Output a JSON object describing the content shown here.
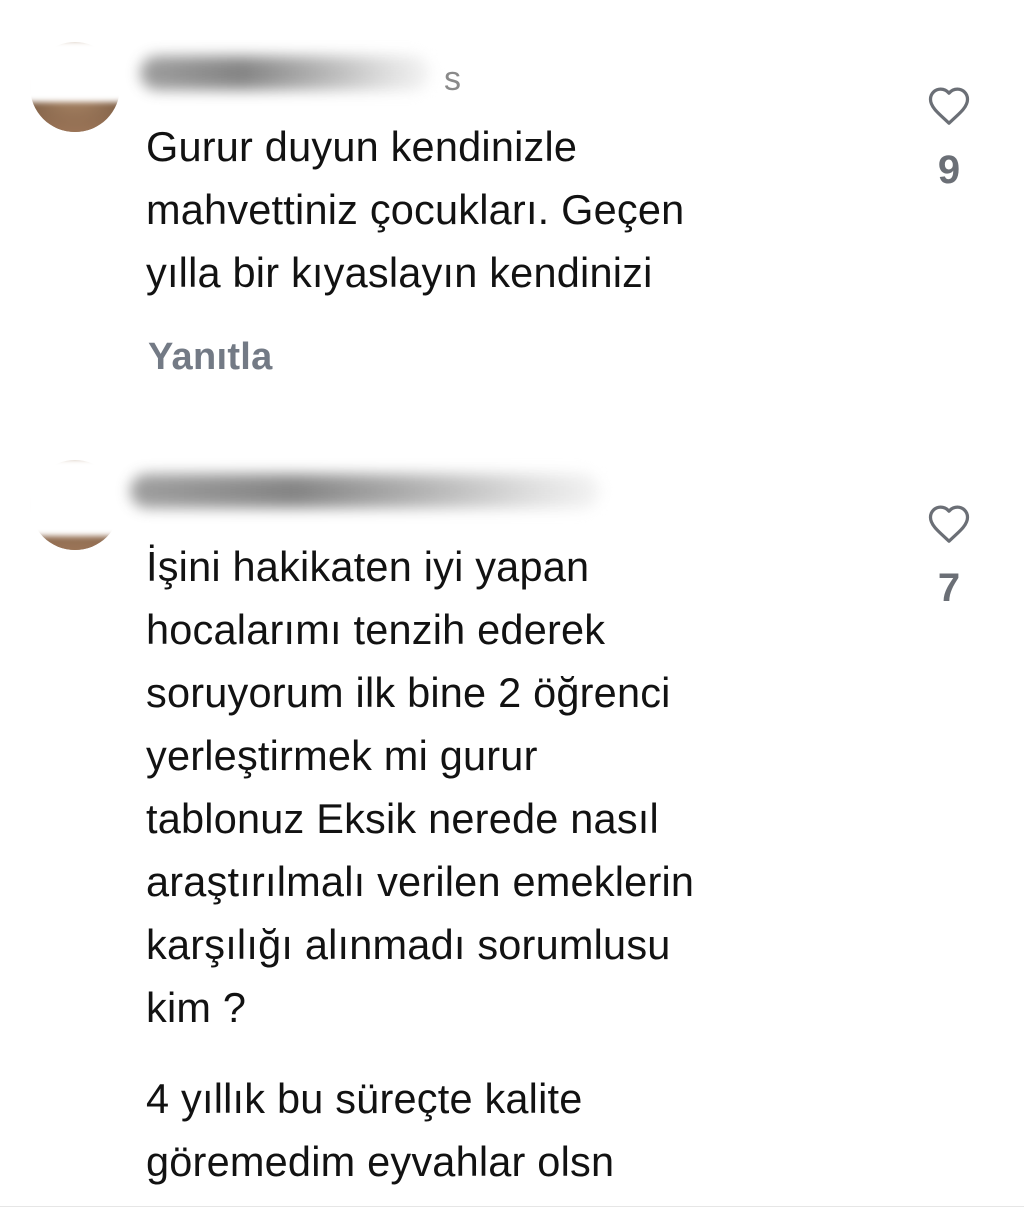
{
  "comments": [
    {
      "username_visible_char": "s",
      "text": "Gurur duyun kendinizle\nmahvettiniz çocukları. Geçen\nyılla bir kıyaslayın kendinizi",
      "reply_label": "Yanıtla",
      "like_count": "9",
      "icon": "heart-outline-icon"
    },
    {
      "text": "İşini hakikaten iyi yapan\nhocalarımı tenzih ederek\nsoruyorum ilk bine 2 öğrenci\nyerleştirmek mi  gurur\ntablonuz Eksik nerede nasıl\naraştırılmalı verilen emeklerin\nkarşılığı alınmadı sorumlusu\nkim ?",
      "text_2": "4 yıllık bu süreçte kalite\ngöremedim eyvahlar olsn",
      "like_count": "7",
      "icon": "heart-outline-icon"
    }
  ],
  "colors": {
    "text": "#121212",
    "secondary": "#737a85",
    "like_count": "#6b6f76",
    "background": "#ffffff"
  }
}
